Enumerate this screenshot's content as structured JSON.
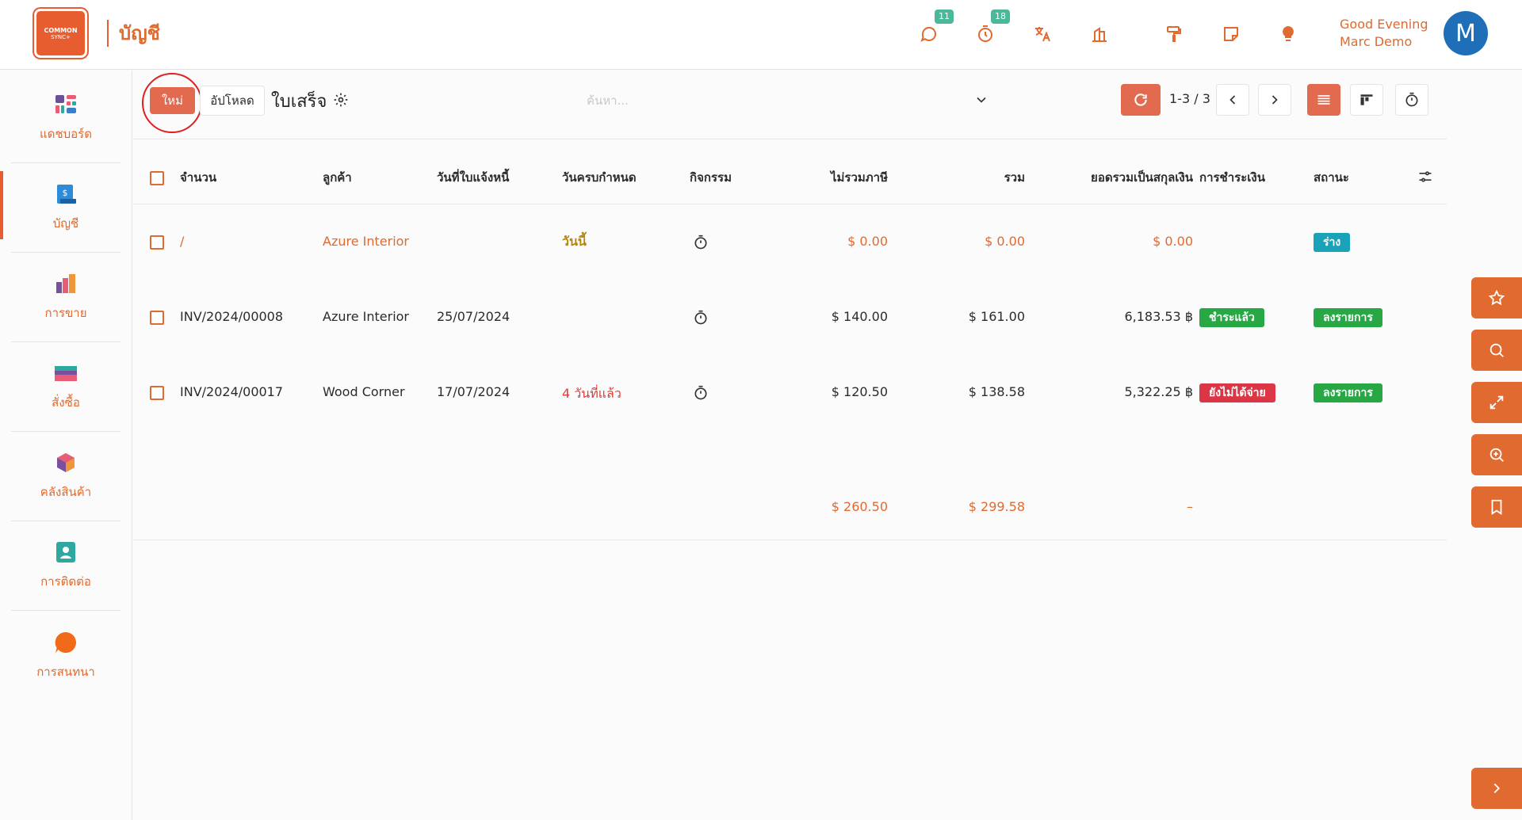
{
  "app": {
    "logo_line1": "COMMON",
    "logo_line2": "SYNC+",
    "title": "บัญชี"
  },
  "topbar": {
    "messages_badge": "11",
    "activities_badge": "18",
    "greeting": "Good Evening",
    "user_name": "Marc Demo",
    "avatar_initial": "M"
  },
  "sidebar": {
    "items": [
      {
        "label": "แดชบอร์ด",
        "icon": "dashboard-icon"
      },
      {
        "label": "บัญชี",
        "icon": "invoicing-icon"
      },
      {
        "label": "การขาย",
        "icon": "sales-icon"
      },
      {
        "label": "สั่งซื้อ",
        "icon": "purchase-icon"
      },
      {
        "label": "คลังสินค้า",
        "icon": "inventory-icon"
      },
      {
        "label": "การติดต่อ",
        "icon": "contacts-icon"
      },
      {
        "label": "การสนทนา",
        "icon": "discuss-icon"
      }
    ]
  },
  "control": {
    "new_label": "ใหม่",
    "upload_label": "อัปโหลด",
    "breadcrumb": "ใบเสร็จ",
    "search_placeholder": "ค้นหา...",
    "pager": "1-3 / 3"
  },
  "table": {
    "headers": {
      "number": "จำนวน",
      "customer": "ลูกค้า",
      "invoice_date": "วันที่ใบแจ้งหนี้",
      "due_date": "วันครบกำหนด",
      "activity": "กิจกรรม",
      "untaxed": "ไม่รวมภาษี",
      "total": "รวม",
      "total_currency": "ยอดรวมเป็นสกุลเงิน",
      "payment": "การชำระเงิน",
      "status": "สถานะ"
    },
    "rows": [
      {
        "number": "/",
        "customer": "Azure Interior",
        "invoice_date": "",
        "due_date": "วันนี้",
        "untaxed": "$ 0.00",
        "total": "$ 0.00",
        "total_currency": "$ 0.00",
        "payment": "",
        "status": "ร่าง"
      },
      {
        "number": "INV/2024/00008",
        "customer": "Azure Interior",
        "invoice_date": "25/07/2024",
        "due_date": "",
        "untaxed": "$ 140.00",
        "total": "$ 161.00",
        "total_currency": "6,183.53 ฿",
        "payment": "ชำระแล้ว",
        "status": "ลงรายการ"
      },
      {
        "number": "INV/2024/00017",
        "customer": "Wood Corner",
        "invoice_date": "17/07/2024",
        "due_date": "4 วันที่แล้ว",
        "untaxed": "$ 120.50",
        "total": "$ 138.58",
        "total_currency": "5,322.25 ฿",
        "payment": "ยังไม่ได้จ่าย",
        "status": "ลงรายการ"
      }
    ],
    "totals": {
      "untaxed": "$ 260.50",
      "total": "$ 299.58",
      "total_currency": "–"
    }
  },
  "colors": {
    "brand": "#e06a2f",
    "button": "#e16a4f",
    "draft": "#1aa3b8",
    "paid": "#28a745",
    "unpaid": "#dc3545"
  }
}
